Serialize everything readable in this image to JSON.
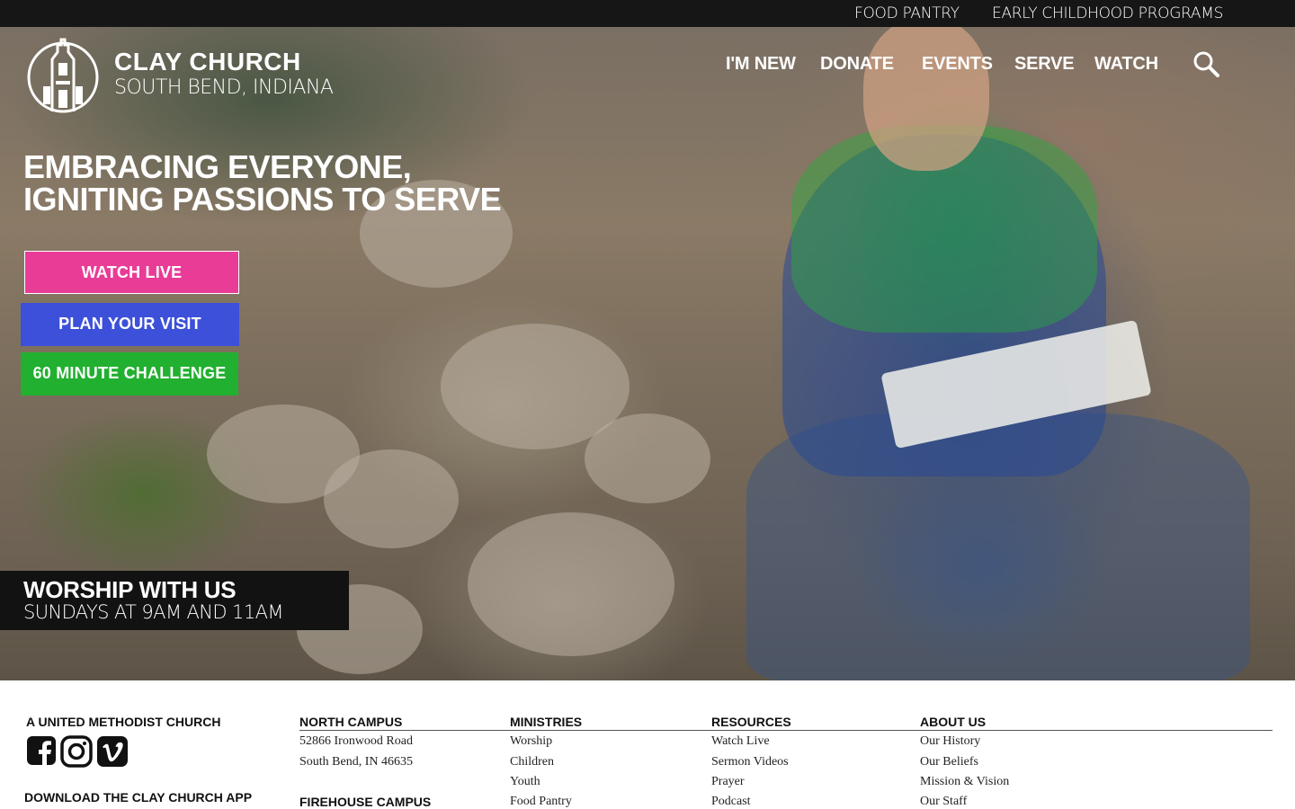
{
  "topbar": {
    "links": [
      "FOOD PANTRY",
      "EARLY CHILDHOOD PROGRAMS"
    ]
  },
  "brand": {
    "name": "CLAY CHURCH",
    "location": "SOUTH BEND, INDIANA"
  },
  "nav": {
    "items": [
      "I'M NEW",
      "DONATE",
      "EVENTS",
      "SERVE",
      "WATCH"
    ],
    "search_icon": "search-icon"
  },
  "hero": {
    "tagline_line1": "EMBRACING EVERYONE,",
    "tagline_line2": "IGNITING PASSIONS TO SERVE",
    "buttons": [
      {
        "label": "WATCH LIVE",
        "color": "#e83c97"
      },
      {
        "label": "PLAN YOUR VISIT",
        "color": "#3d50d9"
      },
      {
        "label": "60 MINUTE CHALLENGE",
        "color": "#21b02f"
      }
    ],
    "worship_title": "WORSHIP WITH US",
    "worship_times": "SUNDAYS AT 9AM AND 11AM"
  },
  "footer": {
    "affiliation": "A UNITED METHODIST CHURCH",
    "social_icons": [
      "facebook-icon",
      "instagram-icon",
      "vimeo-icon"
    ],
    "app_heading": "DOWNLOAD THE CLAY CHURCH APP",
    "north_campus": {
      "heading": "NORTH CAMPUS",
      "address1": "52866 Ironwood Road",
      "address2": "South Bend, IN 46635"
    },
    "firehouse_campus": {
      "heading": "FIREHOUSE CAMPUS"
    },
    "ministries": {
      "heading": "MINISTRIES",
      "links": [
        "Worship",
        "Children",
        "Youth",
        "Food Pantry"
      ]
    },
    "resources": {
      "heading": "RESOURCES",
      "links": [
        "Watch Live",
        "Sermon Videos",
        "Prayer",
        "Podcast"
      ]
    },
    "about": {
      "heading": "ABOUT US",
      "links": [
        "Our History",
        "Our Beliefs",
        "Mission & Vision",
        "Our Staff"
      ]
    }
  }
}
